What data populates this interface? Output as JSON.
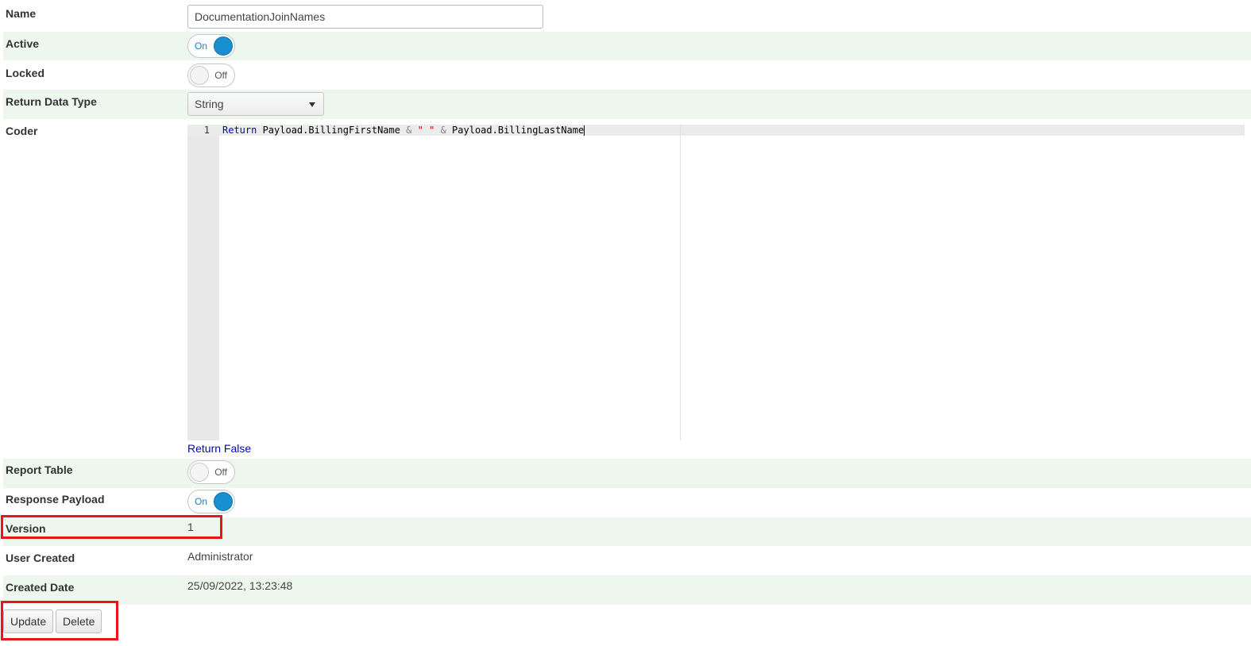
{
  "form": {
    "name": {
      "label": "Name",
      "value": "DocumentationJoinNames"
    },
    "active": {
      "label": "Active",
      "state": "On"
    },
    "locked": {
      "label": "Locked",
      "state": "Off"
    },
    "return_data_type": {
      "label": "Return Data Type",
      "value": "String"
    },
    "coder": {
      "label": "Coder",
      "line_number": "1",
      "code": {
        "keyword": "Return",
        "part1": " Payload.BillingFirstName ",
        "op1": "&",
        "space1": " ",
        "str": "\" \"",
        "space2": " ",
        "op2": "&",
        "part2": " Payload.BillingLastName"
      },
      "footer": "Return False"
    },
    "report_table": {
      "label": "Report Table",
      "state": "Off"
    },
    "response_payload": {
      "label": "Response Payload",
      "state": "On"
    },
    "version": {
      "label": "Version",
      "value": "1"
    },
    "user_created": {
      "label": "User Created",
      "value": "Administrator"
    },
    "created_date": {
      "label": "Created Date",
      "value": "25/09/2022, 13:23:48"
    }
  },
  "actions": {
    "update_label": "Update",
    "delete_label": "Delete"
  },
  "colors": {
    "alt_row_bg": "#edf7ee",
    "toggle_on": "#1a8fd0",
    "highlight": "#e8161a",
    "code_keyword": "#0000c8",
    "code_string": "#d00000"
  }
}
